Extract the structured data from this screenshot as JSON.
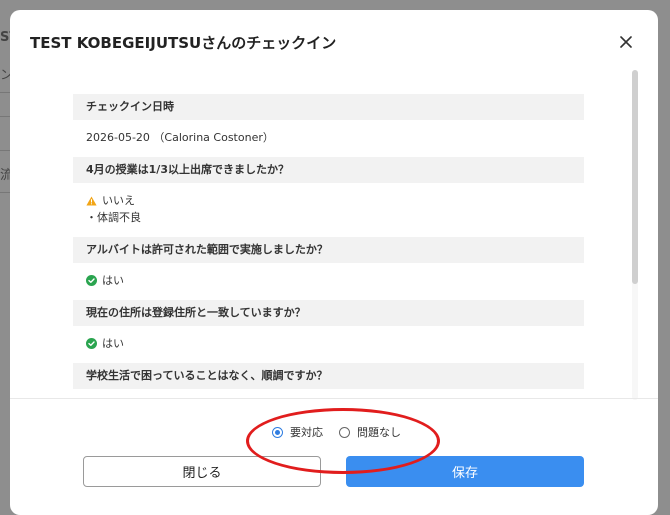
{
  "background": {
    "fragments": [
      "ST",
      "ン",
      "流"
    ]
  },
  "modal": {
    "title": "TEST KOBEGEIJUTSUさんのチェックイン",
    "close_glyph": "×",
    "sections": [
      {
        "question": "チェックイン日時",
        "answer": "2026-05-20 （Calorina Costoner）"
      },
      {
        "question": "4月の授業は1/3以上出席できましたか？",
        "answer": "いいえ",
        "status": "warning",
        "note": "・体調不良"
      },
      {
        "question": "アルバイトは許可された範囲で実施しましたか？",
        "answer": "はい",
        "status": "ok"
      },
      {
        "question": "現在の住所は登録住所と一致していますか？",
        "answer": "はい",
        "status": "ok"
      },
      {
        "question": "学校生活で困っていることはなく、順調ですか？"
      }
    ],
    "radio": {
      "options": [
        "要対応",
        "問題なし"
      ],
      "selected": "要対応"
    },
    "buttons": {
      "close_label": "閉じる",
      "save_label": "保存"
    }
  },
  "colors": {
    "primary": "#3a8ef0",
    "ok": "#2aa44f",
    "warning": "#f2a516",
    "annotation": "#e11d1d"
  },
  "icons": {
    "warning": "warning-triangle-icon",
    "ok": "check-circle-icon",
    "close": "close-icon"
  }
}
